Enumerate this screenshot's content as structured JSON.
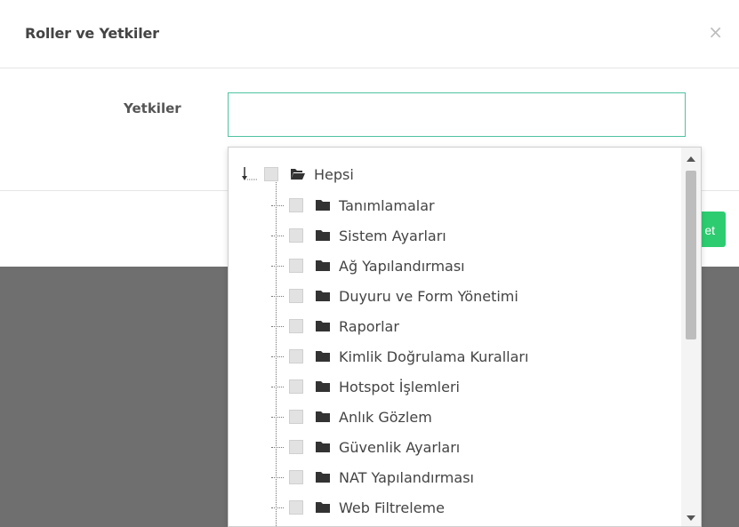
{
  "modal": {
    "title": "Roller ve Yetkiler",
    "close_symbol": "×",
    "field_label": "Yetkiler",
    "save_label": "et"
  },
  "tree": {
    "root": {
      "label": "Hepsi",
      "icon": "folder-open-icon"
    },
    "items": [
      {
        "label": "Tanımlamalar",
        "icon": "folder-icon"
      },
      {
        "label": "Sistem Ayarları",
        "icon": "folder-icon"
      },
      {
        "label": "Ağ Yapılandırması",
        "icon": "folder-icon"
      },
      {
        "label": "Duyuru ve Form Yönetimi",
        "icon": "folder-icon"
      },
      {
        "label": "Raporlar",
        "icon": "folder-icon"
      },
      {
        "label": "Kimlik Doğrulama Kuralları",
        "icon": "folder-icon"
      },
      {
        "label": "Hotspot İşlemleri",
        "icon": "folder-icon"
      },
      {
        "label": "Anlık Gözlem",
        "icon": "folder-icon"
      },
      {
        "label": "Güvenlik Ayarları",
        "icon": "folder-icon"
      },
      {
        "label": "NAT Yapılandırması",
        "icon": "folder-icon"
      },
      {
        "label": "Web Filtreleme",
        "icon": "folder-icon"
      }
    ]
  },
  "colors": {
    "accent": "#4fc3a1",
    "button": "#2ecc71",
    "backdrop": "#6f6f6f"
  }
}
